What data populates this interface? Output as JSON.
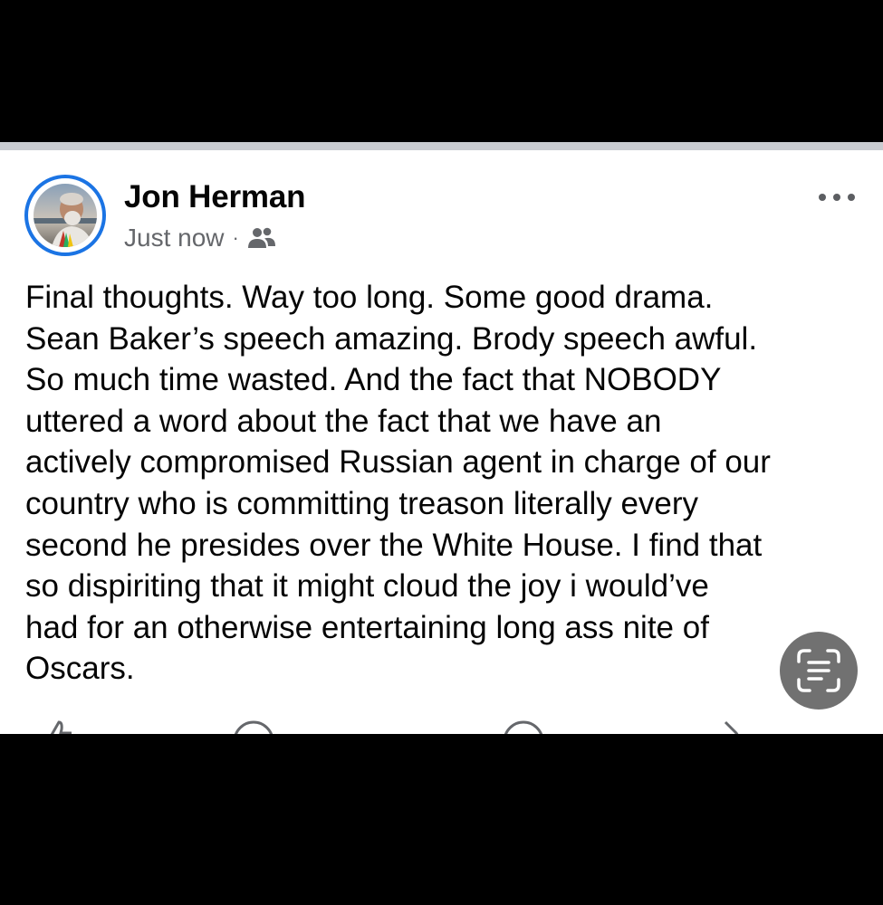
{
  "post": {
    "author": "Jon Herman",
    "timestamp": "Just now",
    "separator": "·",
    "audience_icon": "friends-icon",
    "more_icon": "more-horizontal-icon",
    "lines": [
      "Final thoughts. Way too long. Some good drama.",
      "Sean Baker’s speech amazing. Brody speech awful.",
      "So much time wasted. And the fact that NOBODY",
      "uttered a word about the fact that we have an",
      "actively compromised Russian agent in charge of our",
      "country who is committing treason literally every",
      "second he presides over the White House. I find that",
      "so dispiriting that it might cloud the joy i would’ve",
      "had for an otherwise entertaining long ass nite of",
      "Oscars."
    ]
  },
  "overlay": {
    "live_text_icon": "text-scan-icon"
  },
  "colors": {
    "accent": "#1b74e4",
    "text_primary": "#050505",
    "text_secondary": "#65676b",
    "divider": "#c9ccd1"
  }
}
